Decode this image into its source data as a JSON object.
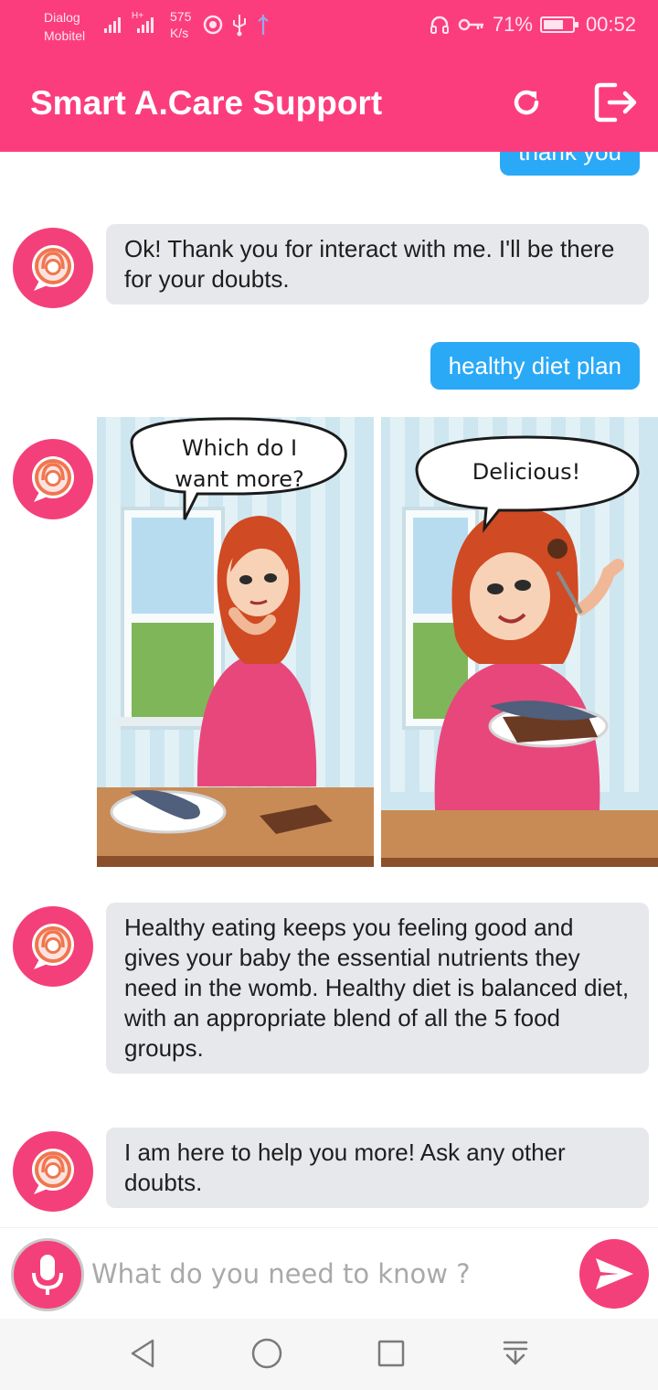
{
  "status_bar": {
    "carrier_line1": "Dialog",
    "carrier_line2": "Mobitel",
    "network_type": "H+",
    "net_speed_value": "575",
    "net_speed_unit": "K/s",
    "icons": [
      "signal-icon",
      "record-icon",
      "usb-icon",
      "usb-debug-icon",
      "headset-icon",
      "vpn-key-icon",
      "battery-icon"
    ],
    "battery_percent": "71%",
    "battery_level": 0.71,
    "time": "00:52"
  },
  "header": {
    "title": "Smart A.Care Support",
    "actions": [
      "refresh-icon",
      "logout-icon"
    ],
    "background": "#fb3d7e"
  },
  "chat": {
    "messages": [
      {
        "from": "user",
        "text": "thank you"
      },
      {
        "from": "bot",
        "text": "Ok! Thank you for interact with me. I'll be there for your doubts."
      },
      {
        "from": "user",
        "text": "healthy diet plan"
      },
      {
        "from": "bot",
        "type": "image",
        "panels": [
          {
            "speech": [
              "Which do I",
              "want more?"
            ]
          },
          {
            "speech": [
              "Delicious!"
            ]
          }
        ]
      },
      {
        "from": "bot",
        "text": "Healthy eating keeps you feeling good and gives your baby the essential nutrients they need in the womb. Healthy diet is balanced diet, with an appropriate blend of all the 5 food groups."
      },
      {
        "from": "bot",
        "text": "I am here to help you more! Ask any other doubts."
      }
    ]
  },
  "input": {
    "placeholder": "What do you need to know ?",
    "value": ""
  },
  "nav_bar": {
    "buttons": [
      "back-icon",
      "home-icon",
      "recents-icon",
      "notification-pull-icon"
    ]
  },
  "colors": {
    "accent": "#fb3d7e",
    "user_bubble": "#2aa9f6",
    "bot_bubble": "#e7e8ec"
  }
}
